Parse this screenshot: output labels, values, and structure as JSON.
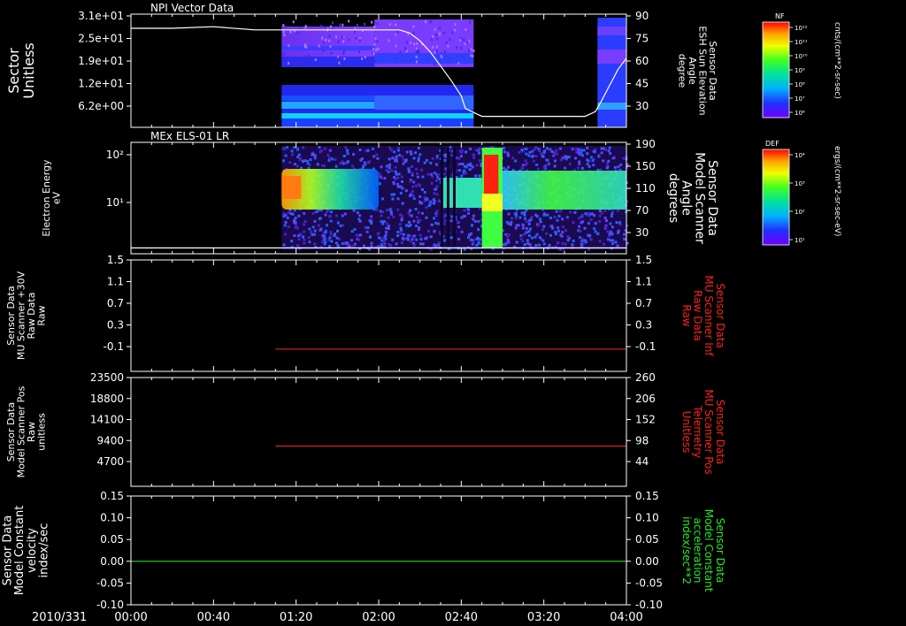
{
  "time_axis": {
    "date_label": "2010/331",
    "tick_labels": [
      "00:00",
      "00:40",
      "01:20",
      "02:00",
      "02:40",
      "03:20",
      "04:00"
    ],
    "range_minutes": [
      0,
      240
    ]
  },
  "colors": {
    "background": "#000000",
    "foreground": "#ffffff",
    "red_trace": "#e02020",
    "green_trace": "#22dd22",
    "right_axis_red": "#ff2020",
    "right_axis_green": "#22ee22"
  },
  "colorbars": [
    {
      "title": "NF",
      "units": "cnts/(cm**2-sr-sec)",
      "tick_labels": [
        "10¹²",
        "10¹¹",
        "10¹⁰",
        "10⁹",
        "10⁸",
        "10⁷",
        "10⁶"
      ]
    },
    {
      "title": "DEF",
      "units": "ergs/(cm**2-sr-sec-eV)",
      "tick_labels": [
        "10⁴",
        "10³",
        "10²",
        "10¹"
      ]
    }
  ],
  "chart_data": [
    {
      "type": "heatmap",
      "title": "NPI Vector Data",
      "ylabel_lines": [
        "Sector",
        "Unitless"
      ],
      "y_tick_labels": [
        "3.1e+01",
        "2.5e+01",
        "1.9e+01",
        "1.2e+01",
        "6.2e+00"
      ],
      "y2label_lines": [
        "Sensor Data",
        "ESH Sun Elevation",
        "Angle",
        "degree"
      ],
      "y2_tick_labels": [
        "90",
        "75",
        "60",
        "45",
        "30"
      ],
      "y2lim": [
        18,
        90
      ],
      "data_coverage_minutes": [
        [
          73,
          166
        ],
        [
          226,
          240
        ]
      ],
      "overlay_line": {
        "name": "ESH Sun Elevation Angle",
        "x_minutes": [
          0,
          20,
          40,
          60,
          80,
          100,
          123,
          130,
          135,
          140,
          145,
          150,
          155,
          160,
          162,
          170,
          180,
          200,
          220,
          225,
          228,
          232,
          236,
          240
        ],
        "y": [
          81,
          81,
          82,
          80,
          80,
          80,
          80,
          80,
          78,
          73,
          66,
          57,
          48,
          38,
          30,
          25,
          25,
          25,
          25,
          28,
          35,
          45,
          55,
          62
        ]
      }
    },
    {
      "type": "heatmap",
      "title": "MEx ELS-01 LR",
      "ylabel_lines": [
        "Electron Energy",
        "eV"
      ],
      "y_tick_labels": [
        "10²",
        "10¹"
      ],
      "y_scale": "log",
      "y2label_lines": [
        "Sensor Data",
        "Model Scanner",
        "Angle",
        "degrees"
      ],
      "y2_tick_labels": [
        "190",
        "150",
        "110",
        "70",
        "30"
      ],
      "y2lim": [
        0,
        190
      ],
      "data_coverage_minutes": [
        [
          73,
          240
        ]
      ],
      "overlay_line": {
        "name": "Model Scanner Angle",
        "x_minutes": [
          0,
          240
        ],
        "y": [
          10,
          10
        ]
      }
    },
    {
      "type": "line",
      "ylabel_lines": [
        "Sensor Data",
        "MU Scanner +30V",
        "Raw Data",
        "Raw"
      ],
      "y_tick_labels": [
        "1.5",
        "1.1",
        "0.7",
        "0.3",
        "-0.1"
      ],
      "ylim": [
        -0.5,
        1.5
      ],
      "y2label_lines": [
        "Sensor Data",
        "MU Scanner Inf",
        "Raw Data",
        "Raw"
      ],
      "y2_tick_labels": [
        "1.5",
        "1.1",
        "0.7",
        "0.3",
        "-0.1"
      ],
      "series": [
        {
          "color": "#e02020",
          "x_minutes": [
            70,
            240
          ],
          "y": [
            -0.1,
            -0.1
          ]
        }
      ]
    },
    {
      "type": "line",
      "ylabel_lines": [
        "Sensor Data",
        "Model Scanner Pos",
        "Raw",
        "unitless"
      ],
      "y_tick_labels": [
        "23500",
        "18800",
        "14100",
        "9400",
        "4700"
      ],
      "ylim": [
        0,
        23500
      ],
      "y2label_lines": [
        "Sensor Data",
        "MU Scanner Pos",
        "Telemetry",
        "Unitless"
      ],
      "y2_tick_labels": [
        "260",
        "206",
        "152",
        "98",
        "44"
      ],
      "series": [
        {
          "color": "#e02020",
          "x_minutes": [
            70,
            240
          ],
          "y": [
            8700,
            8700
          ]
        }
      ]
    },
    {
      "type": "line",
      "ylabel_lines": [
        "Sensor Data",
        "Model Constant",
        "velocity",
        "index/sec"
      ],
      "y_tick_labels": [
        "0.15",
        "0.10",
        "0.05",
        "0.00",
        "-0.05",
        "-0.10"
      ],
      "ylim": [
        -0.1,
        0.15
      ],
      "y2label_lines": [
        "Sensor Data",
        "Model Constant",
        "acceleration",
        "index/sec**2"
      ],
      "y2_tick_labels": [
        "0.15",
        "0.10",
        "0.05",
        "0.00",
        "-0.05",
        "-0.10"
      ],
      "series": [
        {
          "color": "#22dd22",
          "x_minutes": [
            0,
            240
          ],
          "y": [
            0.0,
            0.0
          ]
        }
      ]
    }
  ]
}
